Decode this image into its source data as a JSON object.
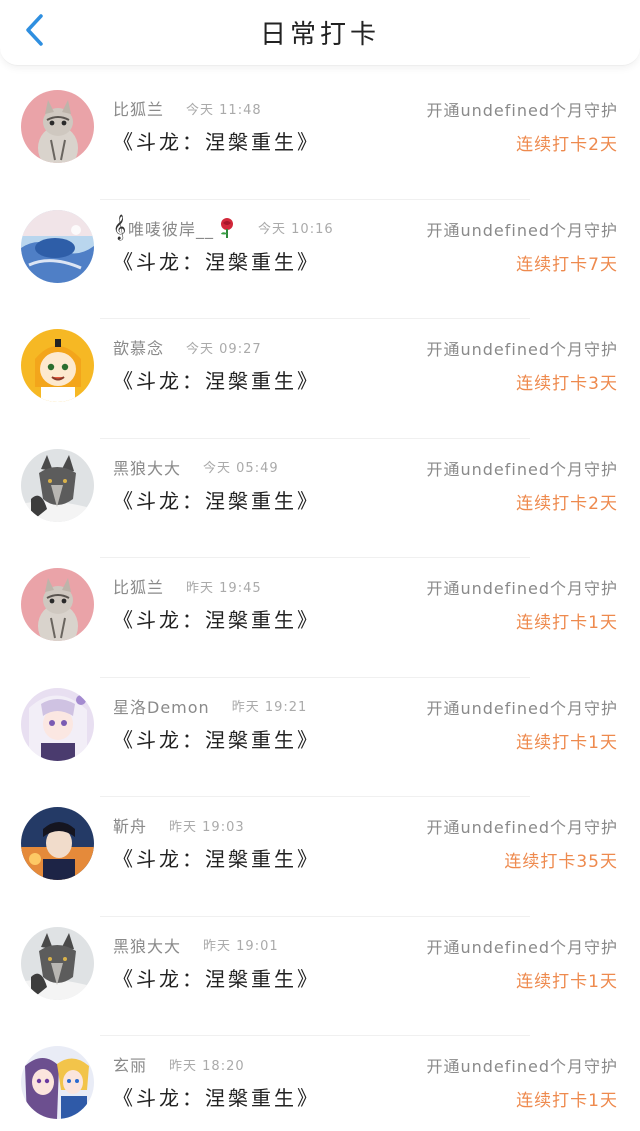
{
  "header": {
    "title": "日常打卡",
    "back_icon": "chevron-left-icon",
    "accent": "#2f8fe0"
  },
  "colors": {
    "streak": "#ee8a4e",
    "secondary_text": "#8a8a8a"
  },
  "rows": [
    {
      "nick": "比狐兰",
      "time": "今天 11:48",
      "book": "《斗龙：涅槃重生》",
      "guard": "开通undefined个月守护",
      "streak": "连续打卡2天",
      "avatar": "cat-avatar"
    },
    {
      "nick": "唯唛彼岸__",
      "time": "今天 10:16",
      "book": "《斗龙：涅槃重生》",
      "guard": "开通undefined个月守护",
      "streak": "连续打卡7天",
      "avatar": "whale-avatar",
      "prefix_icon": "music-note-icon",
      "suffix_icon": "rose-icon"
    },
    {
      "nick": "歆慕念",
      "time": "今天 09:27",
      "book": "《斗龙：涅槃重生》",
      "guard": "开通undefined个月守护",
      "streak": "连续打卡3天",
      "avatar": "cartoon-girl-avatar"
    },
    {
      "nick": "黑狼大大",
      "time": "今天 05:49",
      "book": "《斗龙：涅槃重生》",
      "guard": "开通undefined个月守护",
      "streak": "连续打卡2天",
      "avatar": "wolf-avatar"
    },
    {
      "nick": "比狐兰",
      "time": "昨天 19:45",
      "book": "《斗龙：涅槃重生》",
      "guard": "开通undefined个月守护",
      "streak": "连续打卡1天",
      "avatar": "cat-avatar"
    },
    {
      "nick": "星洛Demon",
      "time": "昨天 19:21",
      "book": "《斗龙：涅槃重生》",
      "guard": "开通undefined个月守护",
      "streak": "连续打卡1天",
      "avatar": "anime-girl-avatar"
    },
    {
      "nick": "靳舟",
      "time": "昨天 19:03",
      "book": "《斗龙：涅槃重生》",
      "guard": "开通undefined个月守护",
      "streak": "连续打卡35天",
      "avatar": "anime-boy-avatar"
    },
    {
      "nick": "黑狼大大",
      "time": "昨天 19:01",
      "book": "《斗龙：涅槃重生》",
      "guard": "开通undefined个月守护",
      "streak": "连续打卡1天",
      "avatar": "wolf-avatar"
    },
    {
      "nick": "玄丽",
      "time": "昨天 18:20",
      "book": "《斗龙：涅槃重生》",
      "guard": "开通undefined个月守护",
      "streak": "连续打卡1天",
      "avatar": "anime-pair-avatar"
    }
  ]
}
